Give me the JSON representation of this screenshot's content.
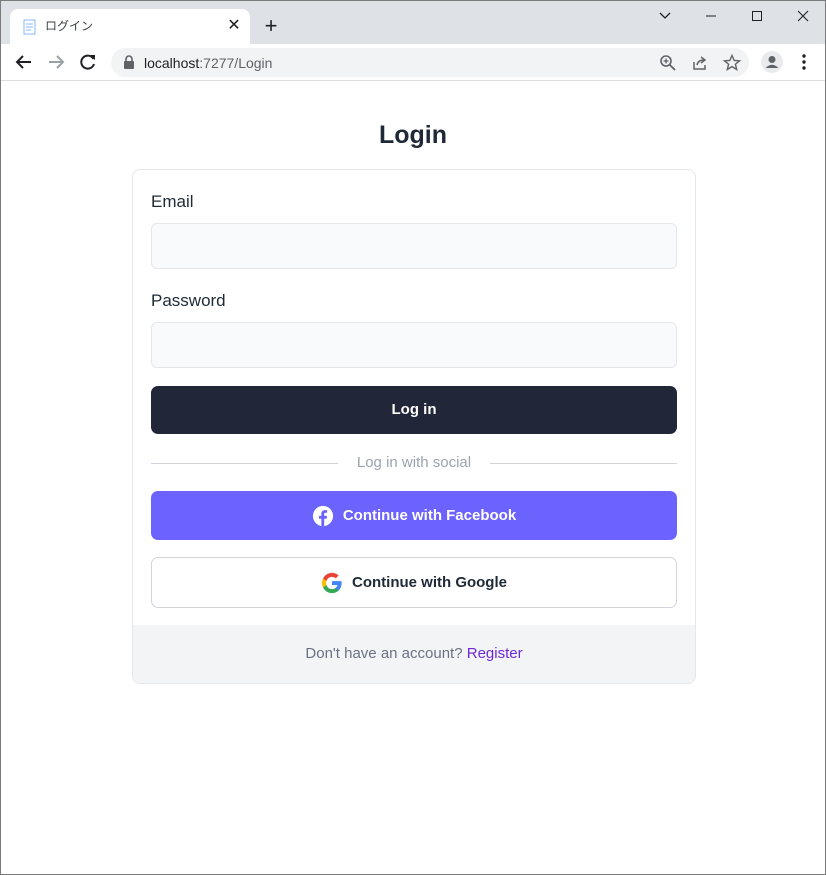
{
  "browser": {
    "tab_title": "ログイン",
    "tab_close": "✕",
    "new_tab": "+",
    "url_host": "localhost",
    "url_path": ":7277/Login"
  },
  "page": {
    "title": "Login"
  },
  "form": {
    "email_label": "Email",
    "email_value": "",
    "password_label": "Password",
    "password_value": "",
    "login_button": "Log in",
    "social_divider": "Log in with social",
    "facebook_button": "Continue with Facebook",
    "google_button": "Continue with Google"
  },
  "footer": {
    "prompt": "Don't have an account?",
    "register_link": "Register"
  },
  "colors": {
    "primary_dark": "#222639",
    "facebook_purple": "#6c63ff",
    "link_purple": "#6d28d9"
  },
  "icons": [
    "page-favicon-icon",
    "close-icon",
    "plus-icon",
    "chevron-down-icon",
    "minimize-icon",
    "maximize-icon",
    "close-window-icon",
    "back-icon",
    "forward-icon",
    "reload-icon",
    "lock-icon",
    "zoom-icon",
    "share-icon",
    "star-icon",
    "profile-icon",
    "menu-icon",
    "facebook-icon",
    "google-icon"
  ]
}
